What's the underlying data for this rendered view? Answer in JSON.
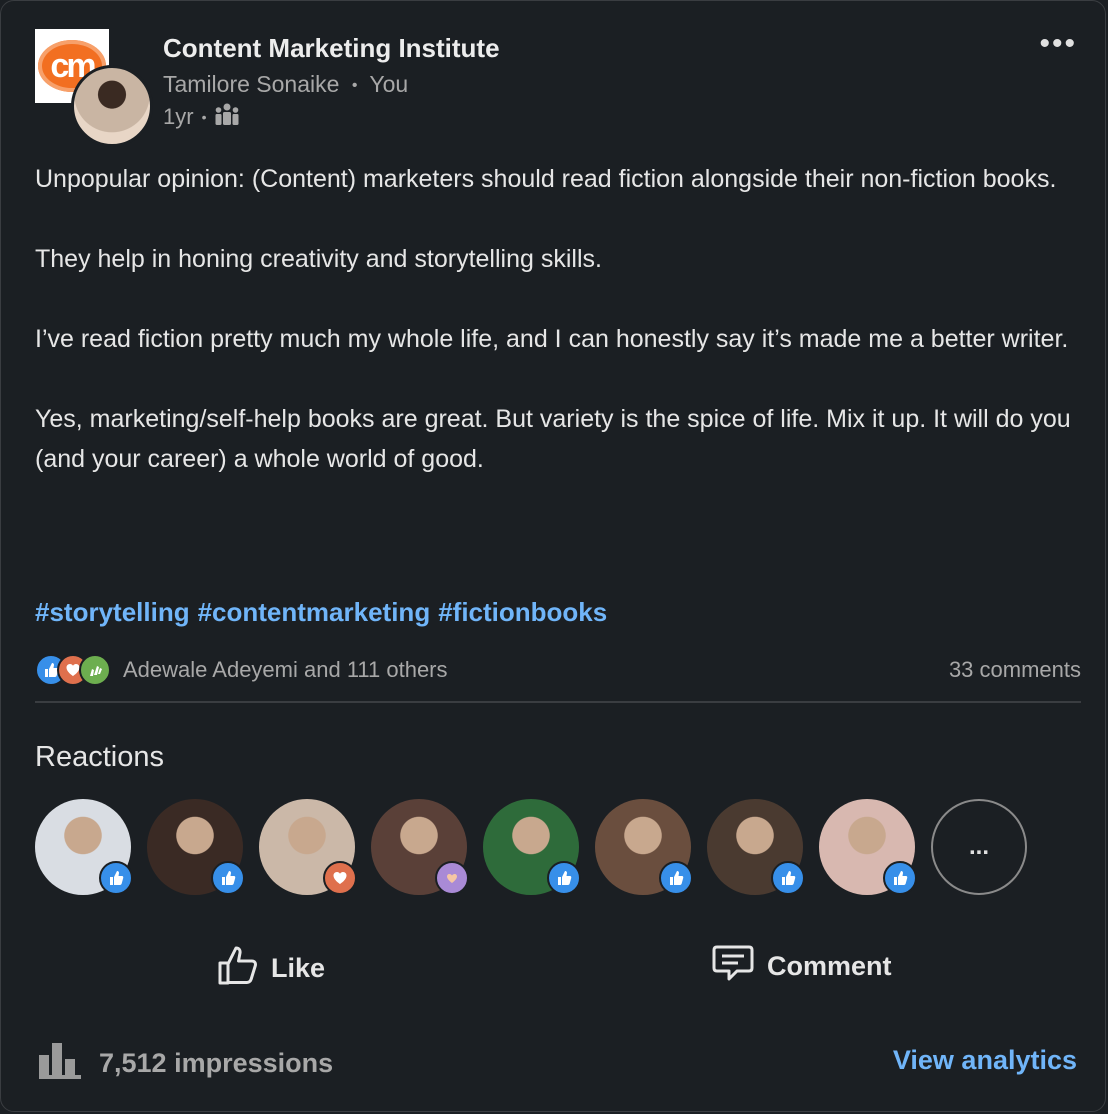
{
  "header": {
    "logo_text": "cm",
    "org_name": "Content Marketing Institute",
    "byline_name": "Tamilore Sonaike",
    "byline_you": "You",
    "separator": "•",
    "time": "1yr",
    "visibility_icon": "people-group-icon",
    "more_icon": "more-options-icon",
    "more_label": "•••"
  },
  "post": {
    "paragraphs": [
      "Unpopular opinion: (Content) marketers should read fiction alongside their non-fiction books.",
      "They help in honing creativity and storytelling skills.",
      "I’ve read fiction pretty much my whole life, and I can honestly say it’s made me a better writer.",
      "Yes, marketing/self-help books are great. But variety is the spice of life. Mix it up. It will do you (and your career) a whole world of good."
    ],
    "hashtags": [
      "#storytelling",
      "#contentmarketing",
      "#fictionbooks"
    ]
  },
  "social": {
    "reaction_icons": [
      "like-icon",
      "love-icon",
      "support-icon"
    ],
    "reactors": "Adewale Adeyemi and 111 others",
    "comments": "33 comments"
  },
  "reactions": {
    "title": "Reactions",
    "avatars": [
      {
        "reaction": "like",
        "bg": "#d9dde3"
      },
      {
        "reaction": "like",
        "bg": "#3a2a24"
      },
      {
        "reaction": "love",
        "bg": "#cbb8a8"
      },
      {
        "reaction": "support",
        "bg": "#5a4038"
      },
      {
        "reaction": "like",
        "bg": "#2e6b3a"
      },
      {
        "reaction": "like",
        "bg": "#6a4e3e"
      },
      {
        "reaction": "like",
        "bg": "#4a3a30"
      },
      {
        "reaction": "like",
        "bg": "#d8b8b0"
      }
    ],
    "more_label": "..."
  },
  "actions": {
    "like_label": "Like",
    "comment_label": "Comment"
  },
  "footer": {
    "impressions": "7,512 impressions",
    "view_analytics": "View analytics"
  },
  "colors": {
    "background": "#1b1f23",
    "accent_link": "#70b5f9",
    "like_blue": "#378fe9",
    "love_orange": "#df704d",
    "brand_orange": "#f26f21"
  }
}
